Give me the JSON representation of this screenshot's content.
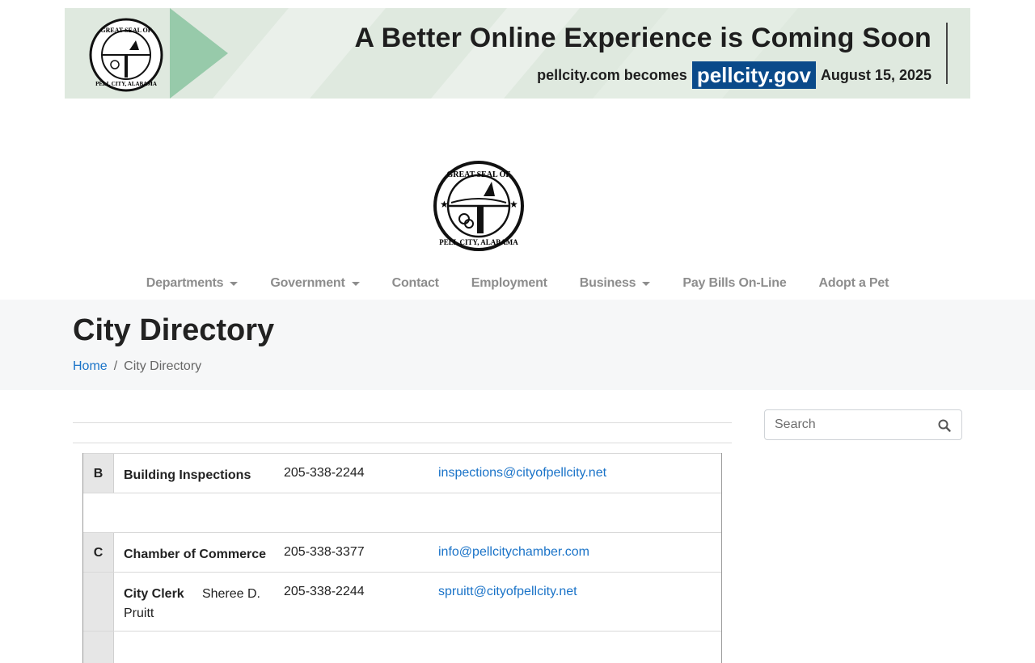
{
  "banner": {
    "headline": "A Better Online Experience is Coming Soon",
    "becomes_text": "pellcity.com becomes",
    "new_domain": "pellcity.gov",
    "date": "August 15, 2025",
    "seal_top_text": "GREAT SEAL OF",
    "seal_bottom_text": "PELL CITY, ALABAMA"
  },
  "logo": {
    "top_text": "GREAT SEAL OF",
    "bottom_text": "PELL CITY, ALABAMA"
  },
  "nav": {
    "items": [
      {
        "label": "Departments",
        "has_dropdown": true
      },
      {
        "label": "Government",
        "has_dropdown": true
      },
      {
        "label": "Contact",
        "has_dropdown": false
      },
      {
        "label": "Employment",
        "has_dropdown": false
      },
      {
        "label": "Business",
        "has_dropdown": true
      },
      {
        "label": "Pay Bills On-Line",
        "has_dropdown": false
      },
      {
        "label": "Adopt a Pet",
        "has_dropdown": false
      }
    ]
  },
  "page": {
    "title": "City Directory",
    "breadcrumb_home": "Home",
    "breadcrumb_separator": "/",
    "breadcrumb_current": "City Directory"
  },
  "search": {
    "placeholder": "Search",
    "icon": "search-icon"
  },
  "directory": {
    "rows": [
      {
        "letter": "B",
        "name": "Building Inspections",
        "contact": "",
        "phone": "205-338-2244",
        "email": "inspections@cityofpellcity.net"
      },
      {
        "letter": "",
        "name": "",
        "contact": "",
        "phone": "",
        "email": ""
      },
      {
        "letter": "C",
        "name": "Chamber of Commerce",
        "contact": "",
        "phone": "205-338-3377",
        "email": "info@pellcitychamber.com"
      },
      {
        "letter": "",
        "name": "City Clerk",
        "contact": "Sheree D. Pruitt",
        "phone": "205-338-2244",
        "email": "spruitt@cityofpellcity.net"
      }
    ]
  },
  "colors": {
    "link": "#1a73c8",
    "nav_text": "#8d8d8d",
    "band_bg": "#f6f7f8",
    "banner_bg": "#dfe9df",
    "gov_badge": "#0a4a8a"
  }
}
